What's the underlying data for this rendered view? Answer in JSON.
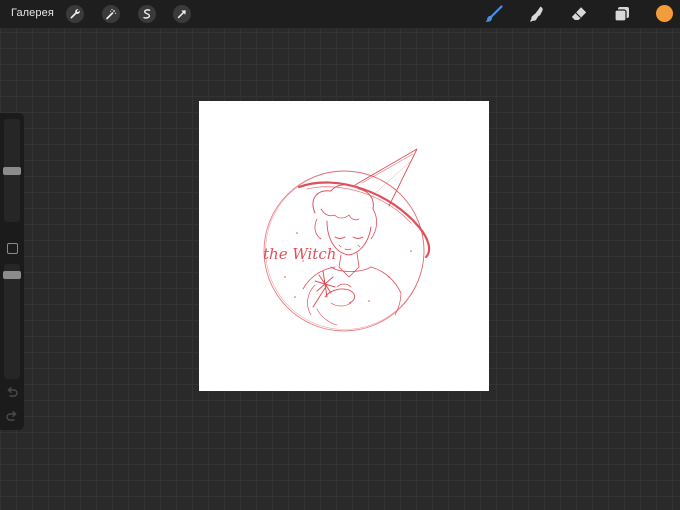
{
  "topbar": {
    "gallery_label": "Галерея",
    "left_tools": [
      "wrench-icon",
      "magic-wand-icon",
      "selection-icon",
      "transform-arrow-icon"
    ],
    "right_tools": [
      "brush-icon",
      "smudge-icon",
      "eraser-icon",
      "layers-icon"
    ],
    "active_tool": "brush-icon",
    "current_color": "#f39c3c"
  },
  "sidebar": {
    "brush_size_level": 0.5,
    "opacity_level": 0.93,
    "tools": [
      "modify-square-icon",
      "undo-icon",
      "redo-icon"
    ]
  },
  "canvas": {
    "background": "#ffffff",
    "sketch_color": "#e0505a",
    "sketch_text": "the Witch"
  }
}
